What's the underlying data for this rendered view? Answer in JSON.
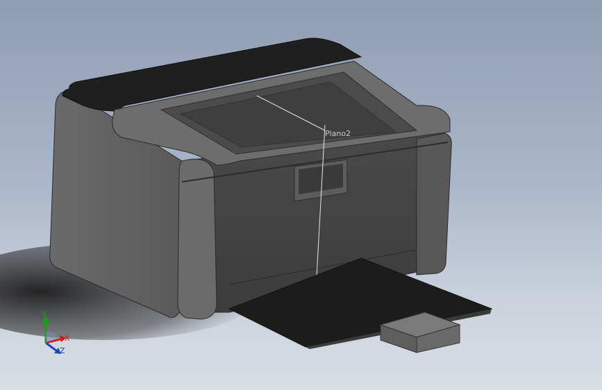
{
  "viewport": {
    "plane_label": "Plano2",
    "triad": {
      "x_label": "X",
      "y_label": "Y",
      "z_label": "Z"
    }
  },
  "colors": {
    "background_top": "#8f9db3",
    "background_bottom": "#d9dde4",
    "body_grey": "#5e5e5e",
    "dark_panel": "#1e1e1e",
    "axis_x": "#d01818",
    "axis_y": "#18a018",
    "axis_z": "#1848c8"
  }
}
